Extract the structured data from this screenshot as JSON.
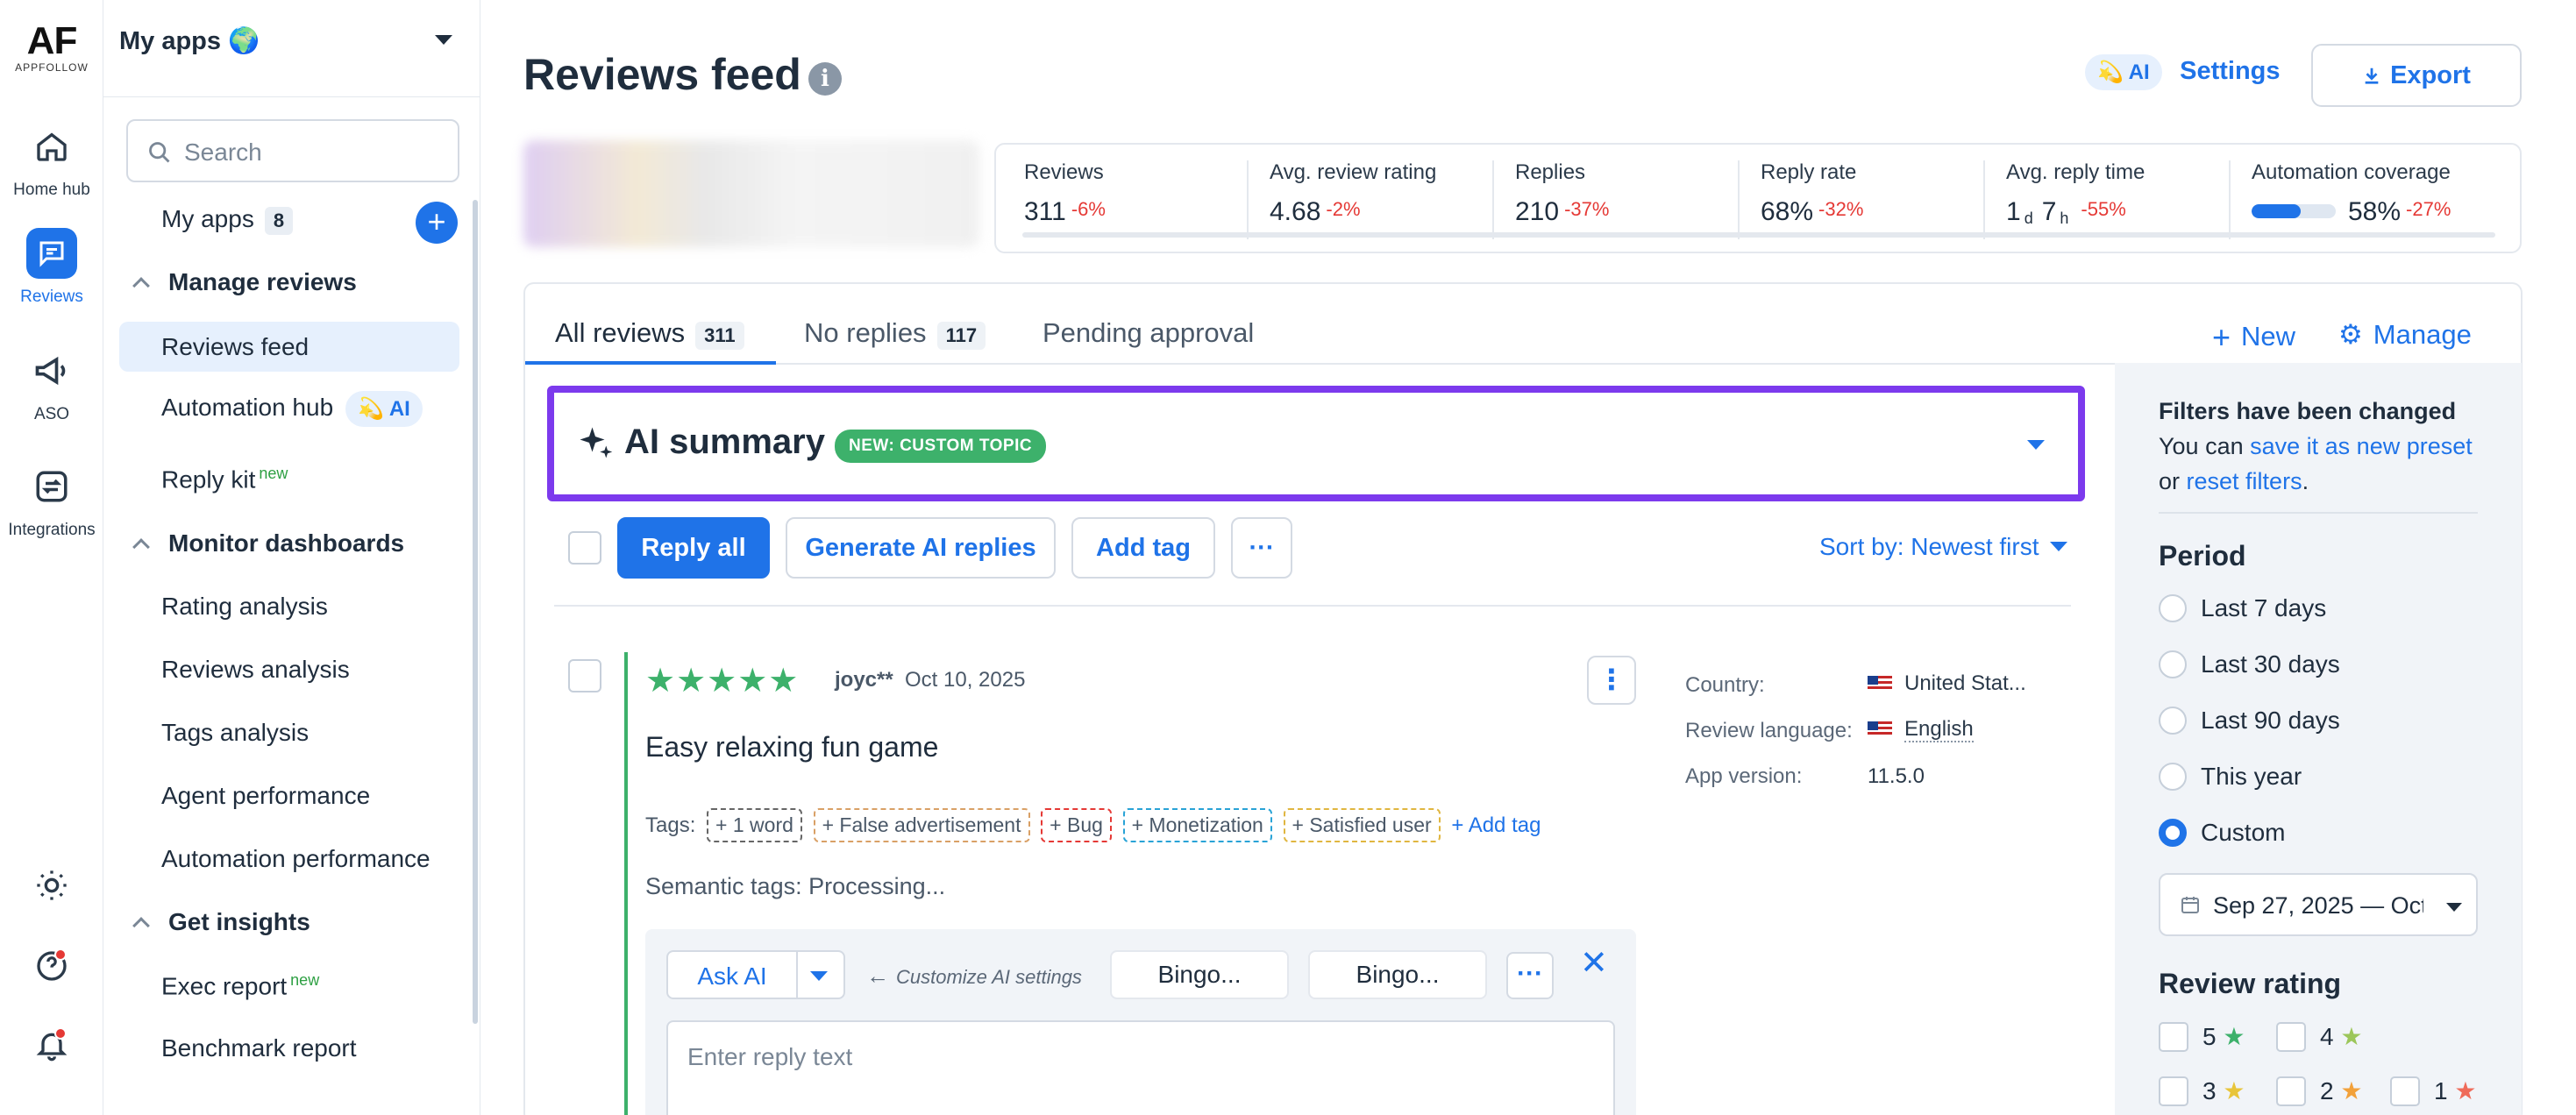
{
  "brand": {
    "logo": "AF",
    "logo_sub": "APPFOLLOW"
  },
  "rail": [
    {
      "label": "Home hub",
      "icon": "home-icon"
    },
    {
      "label": "Reviews",
      "icon": "chat-bubble-icon",
      "active": true
    },
    {
      "label": "ASO",
      "icon": "megaphone-icon"
    },
    {
      "label": "Integrations",
      "icon": "sync-icon"
    }
  ],
  "sidenav": {
    "app_selector": "My apps 🌍",
    "search_placeholder": "Search",
    "my_apps": "My apps",
    "my_apps_count": "8",
    "manage_reviews": "Manage reviews",
    "reviews_feed": "Reviews feed",
    "automation_hub": "Automation hub",
    "ai_badge": "AI",
    "reply_kit": "Reply kit",
    "new_label": "new",
    "monitor_dashboards": "Monitor dashboards",
    "rating_analysis": "Rating analysis",
    "reviews_analysis": "Reviews analysis",
    "tags_analysis": "Tags analysis",
    "agent_performance": "Agent performance",
    "automation_performance": "Automation performance",
    "get_insights": "Get insights",
    "exec_report": "Exec report",
    "benchmark_report": "Benchmark report"
  },
  "header": {
    "title": "Reviews feed",
    "info": "i",
    "ai_label": "AI",
    "settings": "Settings",
    "export": "Export"
  },
  "stats": [
    {
      "label": "Reviews",
      "value": "311",
      "delta": "-6%"
    },
    {
      "label": "Avg. review rating",
      "value": "4.68",
      "delta": "-2%"
    },
    {
      "label": "Replies",
      "value": "210",
      "delta": "-37%"
    },
    {
      "label": "Reply rate",
      "value": "68%",
      "delta": "-32%"
    },
    {
      "label": "Avg. reply time",
      "value_d": "1",
      "unit_d": "d",
      "value_h": "7",
      "unit_h": "h",
      "delta": "-55%"
    },
    {
      "label": "Automation coverage",
      "value": "58%",
      "delta": "-27%",
      "coverage_fraction": 0.58
    }
  ],
  "tabs": {
    "all": "All reviews",
    "all_count": "311",
    "no_replies": "No replies",
    "no_replies_count": "117",
    "pending": "Pending approval",
    "new": "New",
    "manage": "Manage"
  },
  "ai_summary": {
    "title": "AI summary",
    "badge": "NEW: CUSTOM TOPIC"
  },
  "toolbar": {
    "reply_all": "Reply all",
    "generate": "Generate AI replies",
    "add_tag": "Add tag",
    "more": "···",
    "sort": "Sort by: Newest first"
  },
  "review": {
    "stars": "★★★★★",
    "rating": 5,
    "author": "joyc**",
    "date": "Oct 10, 2025",
    "title": "Easy relaxing fun game",
    "tags_label": "Tags:",
    "tags": [
      {
        "text": "+ 1 word",
        "color": "#666666"
      },
      {
        "text": "+ False advertisement",
        "color": "#d9a066"
      },
      {
        "text": "+ Bug",
        "color": "#e53935"
      },
      {
        "text": "+ Monetization",
        "color": "#29a3d6"
      },
      {
        "text": "+ Satisfied user",
        "color": "#e0b640"
      }
    ],
    "add_tag": "+ Add tag",
    "semantic_label": "Semantic tags:",
    "semantic_value": "Processing...",
    "country_label": "Country:",
    "country": "United Stat...",
    "language_label": "Review language:",
    "language": "English",
    "version_label": "App version:",
    "version": "11.5.0"
  },
  "reply": {
    "ask_ai": "Ask AI",
    "customize": "Customize AI settings",
    "bingo1": "Bingo...",
    "bingo2": "Bingo...",
    "placeholder": "Enter reply text",
    "close": "✕"
  },
  "filters": {
    "changed": "Filters have been changed",
    "you_can": "You can",
    "save_preset": "save it as new preset",
    "or": "or",
    "reset": "reset filters",
    "period": "Period",
    "options": [
      "Last 7 days",
      "Last 30 days",
      "Last 90 days",
      "This year",
      "Custom"
    ],
    "selected": "Custom",
    "date_range": "Sep 27, 2025 — Oct",
    "review_rating": "Review rating",
    "ratings": [
      "5",
      "4",
      "3",
      "2",
      "1"
    ]
  },
  "colors": {
    "accent": "#1f73e8",
    "ai_border": "#7c3aed",
    "positive": "#3db16b",
    "negative": "#e53935"
  }
}
